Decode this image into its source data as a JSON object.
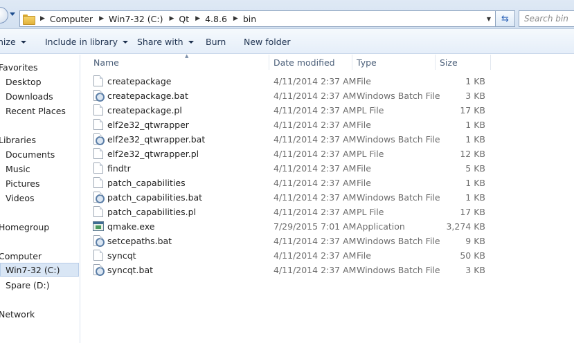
{
  "address": {
    "crumbs": [
      "Computer",
      "Win7-32 (C:)",
      "Qt",
      "4.8.6",
      "bin"
    ],
    "search_placeholder": "Search bin"
  },
  "toolbar": {
    "organize": "nize",
    "include_in_library": "Include in library",
    "share_with": "Share with",
    "burn": "Burn",
    "new_folder": "New folder"
  },
  "nav": {
    "favorites": "Favorites",
    "desktop": "Desktop",
    "downloads": "Downloads",
    "recent_places": "Recent Places",
    "libraries": "Libraries",
    "documents": "Documents",
    "music": "Music",
    "pictures": "Pictures",
    "videos": "Videos",
    "homegroup": "Homegroup",
    "computer": "Computer",
    "win7": "Win7-32 (C:)",
    "spare": "Spare (D:)",
    "network": "Network"
  },
  "columns": {
    "name": "Name",
    "date": "Date modified",
    "type": "Type",
    "size": "Size"
  },
  "files": [
    {
      "name": "createpackage",
      "date": "4/11/2014 2:37 AM",
      "type": "File",
      "size": "1 KB",
      "icon": "file-icon"
    },
    {
      "name": "createpackage.bat",
      "date": "4/11/2014 2:37 AM",
      "type": "Windows Batch File",
      "size": "3 KB",
      "icon": "batch-file-icon"
    },
    {
      "name": "createpackage.pl",
      "date": "4/11/2014 2:37 AM",
      "type": "PL File",
      "size": "17 KB",
      "icon": "file-icon"
    },
    {
      "name": "elf2e32_qtwrapper",
      "date": "4/11/2014 2:37 AM",
      "type": "File",
      "size": "1 KB",
      "icon": "file-icon"
    },
    {
      "name": "elf2e32_qtwrapper.bat",
      "date": "4/11/2014 2:37 AM",
      "type": "Windows Batch File",
      "size": "1 KB",
      "icon": "batch-file-icon"
    },
    {
      "name": "elf2e32_qtwrapper.pl",
      "date": "4/11/2014 2:37 AM",
      "type": "PL File",
      "size": "12 KB",
      "icon": "file-icon"
    },
    {
      "name": "findtr",
      "date": "4/11/2014 2:37 AM",
      "type": "File",
      "size": "5 KB",
      "icon": "file-icon"
    },
    {
      "name": "patch_capabilities",
      "date": "4/11/2014 2:37 AM",
      "type": "File",
      "size": "1 KB",
      "icon": "file-icon"
    },
    {
      "name": "patch_capabilities.bat",
      "date": "4/11/2014 2:37 AM",
      "type": "Windows Batch File",
      "size": "1 KB",
      "icon": "batch-file-icon"
    },
    {
      "name": "patch_capabilities.pl",
      "date": "4/11/2014 2:37 AM",
      "type": "PL File",
      "size": "17 KB",
      "icon": "file-icon"
    },
    {
      "name": "qmake.exe",
      "date": "7/29/2015 7:01 AM",
      "type": "Application",
      "size": "3,274 KB",
      "icon": "application-icon"
    },
    {
      "name": "setcepaths.bat",
      "date": "4/11/2014 2:37 AM",
      "type": "Windows Batch File",
      "size": "9 KB",
      "icon": "batch-file-icon"
    },
    {
      "name": "syncqt",
      "date": "4/11/2014 2:37 AM",
      "type": "File",
      "size": "50 KB",
      "icon": "file-icon"
    },
    {
      "name": "syncqt.bat",
      "date": "4/11/2014 2:37 AM",
      "type": "Windows Batch File",
      "size": "3 KB",
      "icon": "batch-file-icon"
    }
  ]
}
